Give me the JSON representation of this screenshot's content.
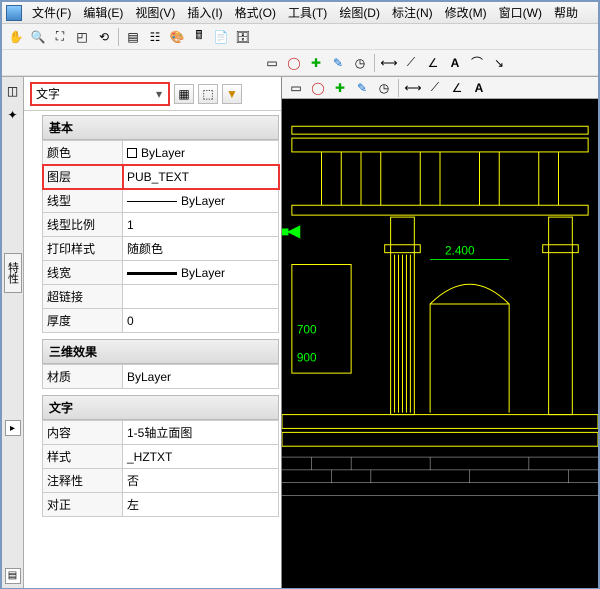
{
  "menu": {
    "file": "文件(F)",
    "edit": "编辑(E)",
    "view": "视图(V)",
    "insert": "插入(I)",
    "format": "格式(O)",
    "tools": "工具(T)",
    "draw": "绘图(D)",
    "annotate": "标注(N)",
    "modify": "修改(M)",
    "window": "窗口(W)",
    "help": "帮助"
  },
  "panel": {
    "selector": "文字",
    "sections": {
      "basic": {
        "title": "基本",
        "rows": {
          "color": {
            "k": "颜色",
            "v": "ByLayer"
          },
          "layer": {
            "k": "图层",
            "v": "PUB_TEXT"
          },
          "linetype": {
            "k": "线型",
            "v": "ByLayer"
          },
          "ltscale": {
            "k": "线型比例",
            "v": "1"
          },
          "plotstyle": {
            "k": "打印样式",
            "v": "随颜色"
          },
          "lineweight": {
            "k": "线宽",
            "v": "ByLayer"
          },
          "hyperlink": {
            "k": "超链接",
            "v": ""
          },
          "thickness": {
            "k": "厚度",
            "v": "0"
          }
        }
      },
      "threeD": {
        "title": "三维效果",
        "rows": {
          "material": {
            "k": "材质",
            "v": "ByLayer"
          }
        }
      },
      "text": {
        "title": "文字",
        "rows": {
          "content": {
            "k": "内容",
            "v": "1-5轴立面图"
          },
          "style": {
            "k": "样式",
            "v": "_HZTXT"
          },
          "annotative": {
            "k": "注释性",
            "v": "否"
          },
          "justify": {
            "k": "对正",
            "v": "左"
          }
        }
      }
    }
  },
  "sidetabs": {
    "props": "特性"
  },
  "dims": {
    "d1": "2.400",
    "d2": "700",
    "d3": "900"
  }
}
